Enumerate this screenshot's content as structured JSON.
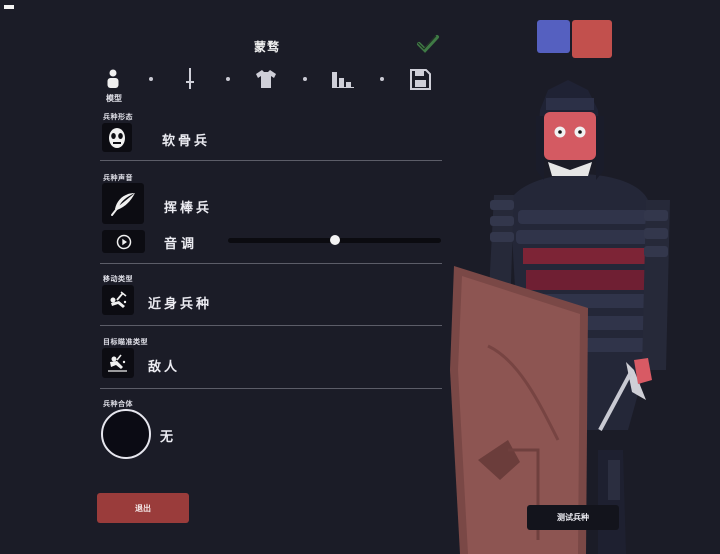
{
  "header": {
    "title": "蒙骛",
    "confirm_icon": "checkmark-icon",
    "team_colors": [
      "#5560c0",
      "#c2504d"
    ]
  },
  "tabs": [
    {
      "icon": "person-icon",
      "label": "模型"
    },
    {
      "icon": "sword-icon",
      "label": ""
    },
    {
      "icon": "shirt-icon",
      "label": ""
    },
    {
      "icon": "stats-icon",
      "label": ""
    },
    {
      "icon": "save-icon",
      "label": ""
    }
  ],
  "sections": {
    "unit_form": {
      "label": "兵种形态",
      "value": "软骨兵",
      "icon": "skull-mask-icon"
    },
    "unit_voice": {
      "label": "兵种声音",
      "value": "挥棒兵",
      "icon": "feather-icon"
    },
    "pitch": {
      "play_icon": "play-icon",
      "label": "音调",
      "value": 0.5
    },
    "movement": {
      "label": "移动类型",
      "value": "近身兵种",
      "icon": "melee-unit-icon"
    },
    "targeting": {
      "label": "目标瞄准类型",
      "value": "敌人",
      "icon": "target-unit-icon"
    },
    "combine": {
      "label": "兵种合体",
      "value": "无"
    }
  },
  "buttons": {
    "exit": "退出",
    "test": "测试兵种"
  }
}
